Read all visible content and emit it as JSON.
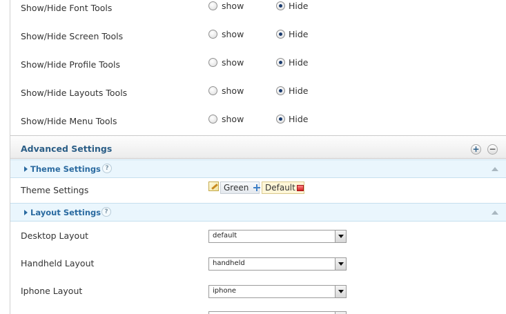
{
  "toggles": [
    {
      "label": "Show/Hide Font Tools",
      "show_label": "show",
      "hide_label": "Hide",
      "selected": "hide"
    },
    {
      "label": "Show/Hide Screen Tools",
      "show_label": "show",
      "hide_label": "Hide",
      "selected": "hide"
    },
    {
      "label": "Show/Hide Profile Tools",
      "show_label": "show",
      "hide_label": "Hide",
      "selected": "hide"
    },
    {
      "label": "Show/Hide Layouts Tools",
      "show_label": "show",
      "hide_label": "Hide",
      "selected": "hide"
    },
    {
      "label": "Show/Hide Menu Tools",
      "show_label": "show",
      "hide_label": "Hide",
      "selected": "hide"
    }
  ],
  "advanced": {
    "title": "Advanced Settings",
    "expand_icon": "plus-circle-icon",
    "collapse_icon": "minus-circle-icon",
    "theme_section": {
      "title": "Theme Settings",
      "help": "?",
      "field_label": "Theme Settings",
      "themes": [
        {
          "name": "Green",
          "icon": "move-cross-icon"
        },
        {
          "name": "Default",
          "icon": "delete-icon"
        }
      ]
    },
    "layout_section": {
      "title": "Layout Settings",
      "help": "?",
      "fields": [
        {
          "label": "Desktop Layout",
          "value": "default"
        },
        {
          "label": "Handheld Layout",
          "value": "handheld"
        },
        {
          "label": "Iphone Layout",
          "value": "iphone"
        }
      ]
    }
  },
  "colors": {
    "accent": "#2a5d86",
    "sub_header_bg": "#eaf6fd",
    "default_chip_bg": "#fff6d8"
  }
}
